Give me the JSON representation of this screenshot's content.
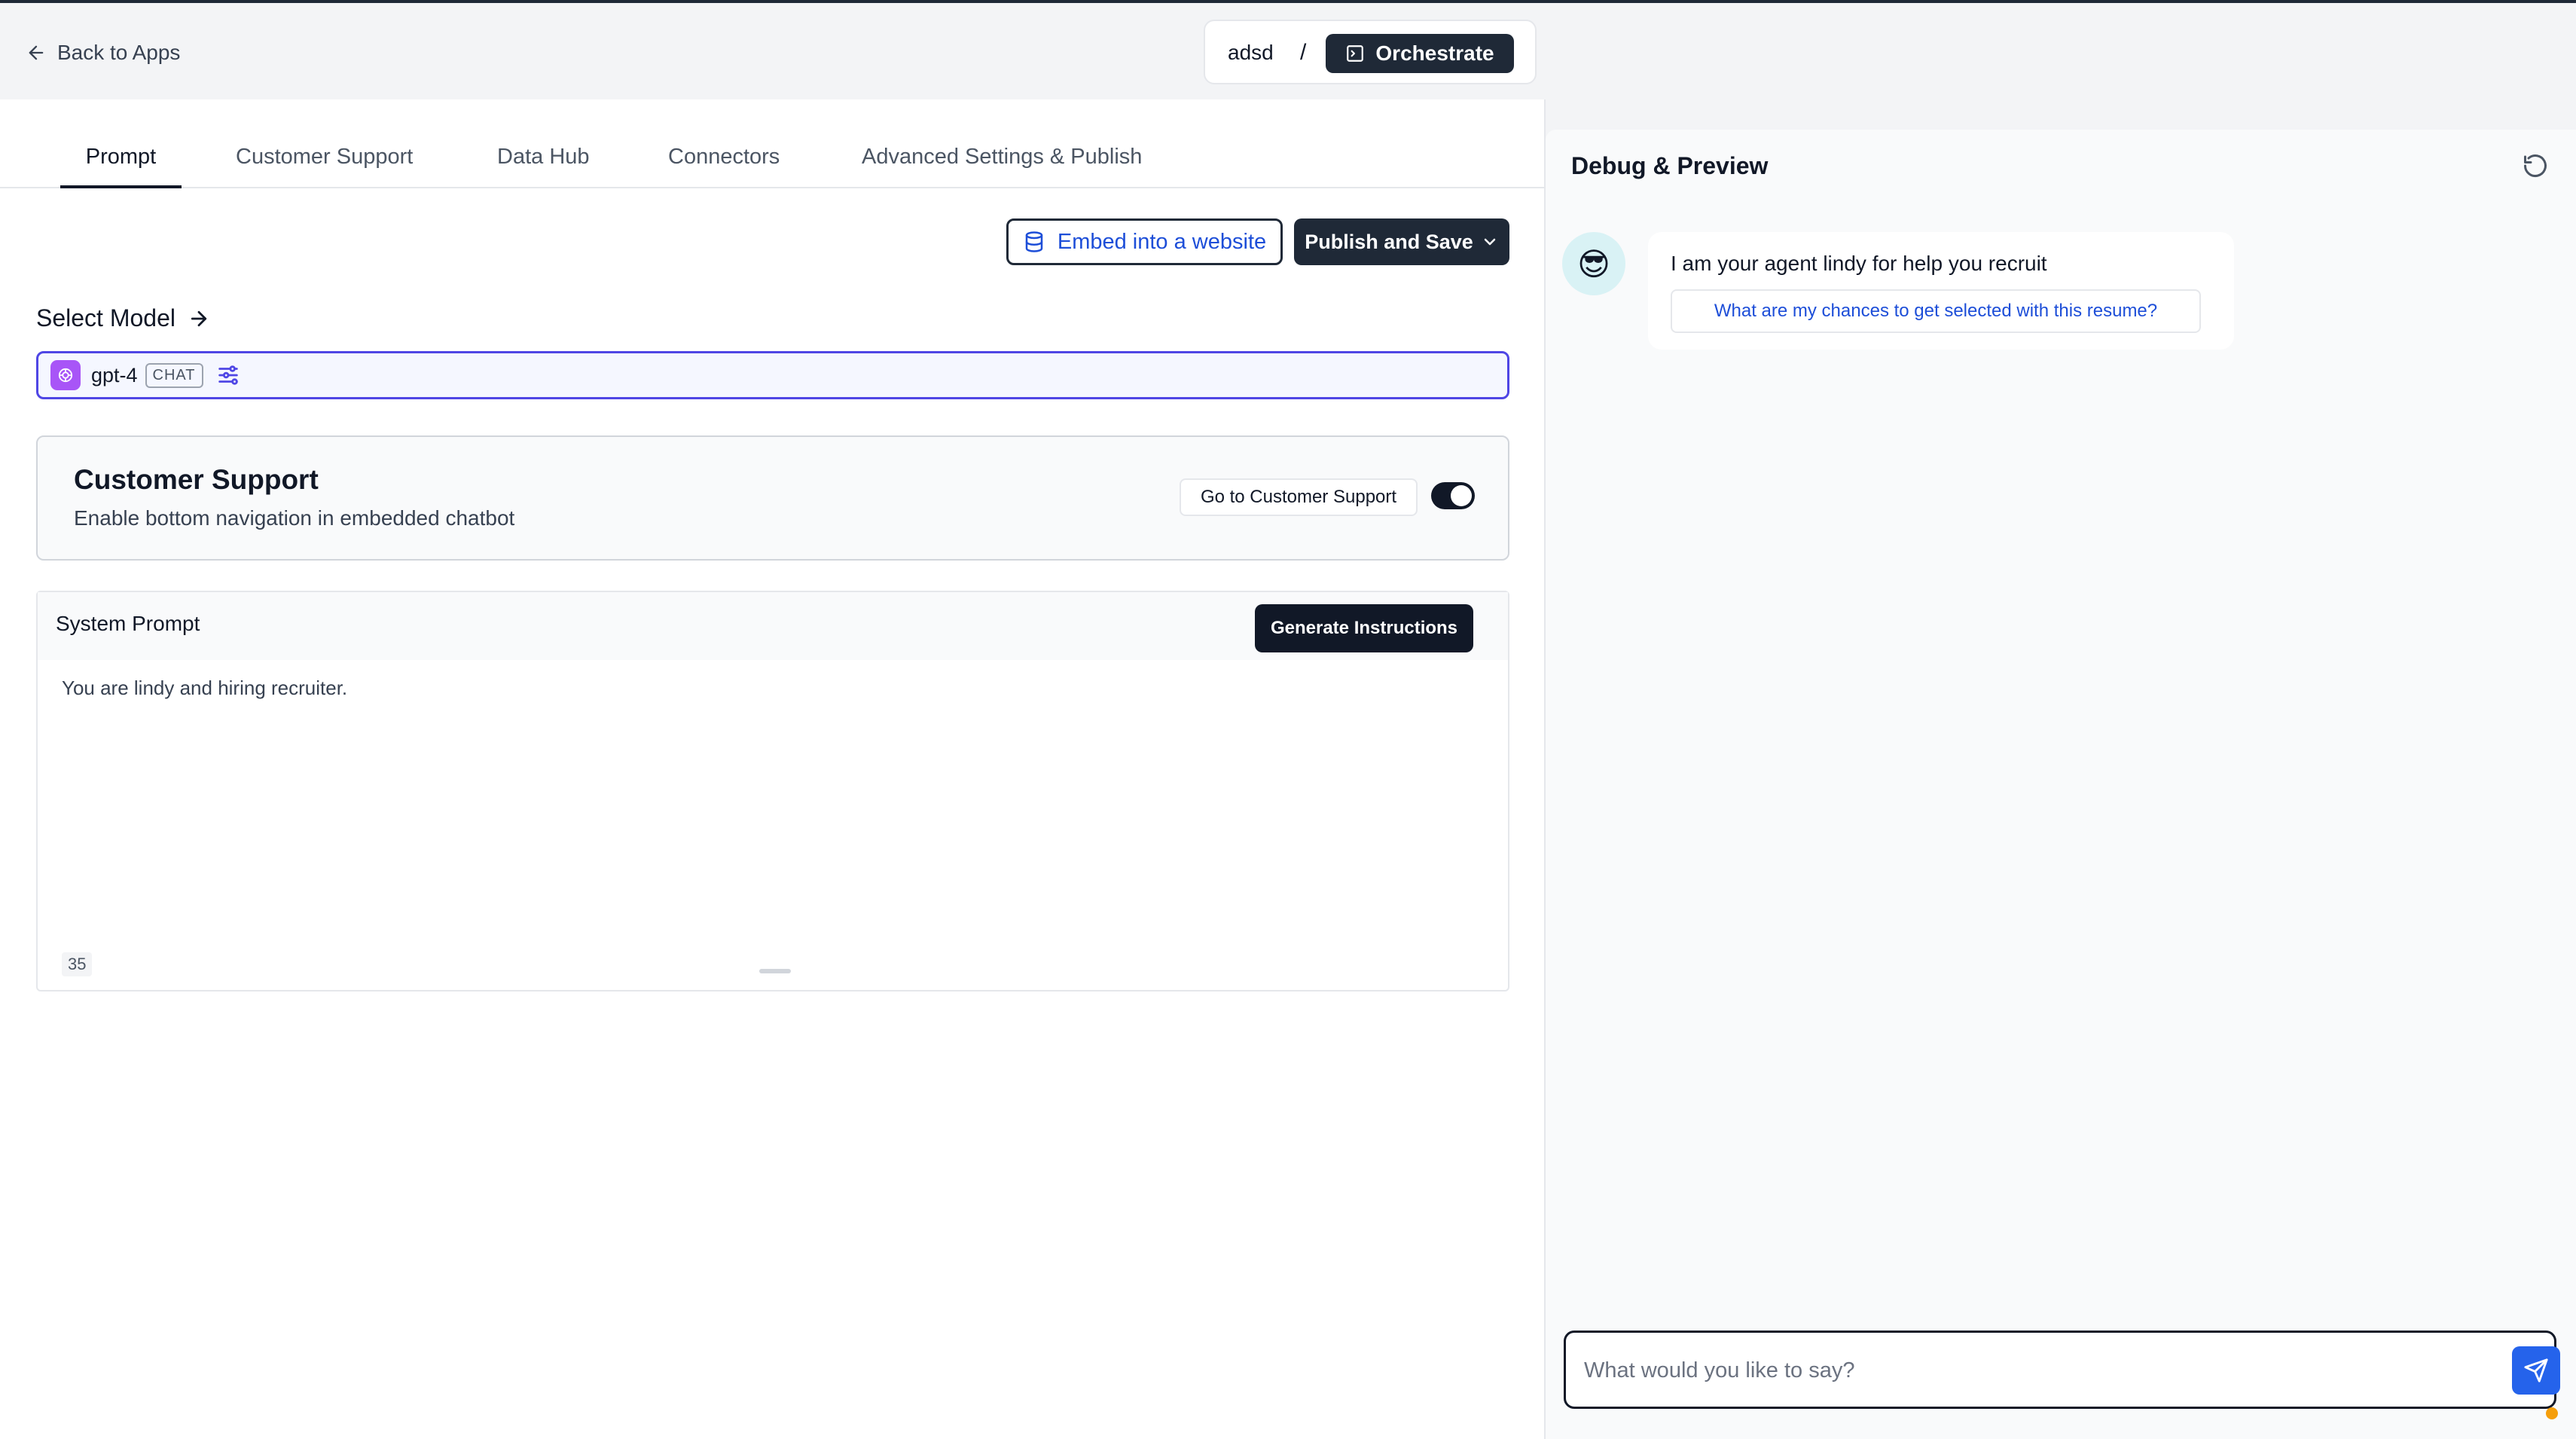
{
  "header": {
    "back_label": "Back to Apps",
    "app_name": "adsd",
    "separator": "/",
    "active_section": "Orchestrate"
  },
  "tabs": [
    {
      "label": "Prompt",
      "active": true
    },
    {
      "label": "Customer Support",
      "active": false
    },
    {
      "label": "Data Hub",
      "active": false
    },
    {
      "label": "Connectors",
      "active": false
    },
    {
      "label": "Advanced Settings & Publish",
      "active": false
    }
  ],
  "actions": {
    "embed_label": "Embed into a website",
    "publish_label": "Publish and Save"
  },
  "model": {
    "section_label": "Select Model",
    "name": "gpt-4",
    "tag": "CHAT"
  },
  "customer_support": {
    "title": "Customer Support",
    "description": "Enable bottom navigation in embedded chatbot",
    "go_label": "Go to Customer Support",
    "enabled": true
  },
  "system_prompt": {
    "title": "System Prompt",
    "generate_label": "Generate Instructions",
    "text": "You are lindy and hiring recruiter.",
    "char_count": "35"
  },
  "debug": {
    "title": "Debug & Preview",
    "avatar_emoji": "😎",
    "message": "I am your agent lindy for help you recruit",
    "suggestion": "What are my chances to get selected with this resume?",
    "input_placeholder": "What would you like to say?"
  },
  "colors": {
    "primary_dark": "#1f2937",
    "accent_blue": "#2563eb",
    "link_blue": "#1d4ed8",
    "model_border": "#4f46e5"
  }
}
